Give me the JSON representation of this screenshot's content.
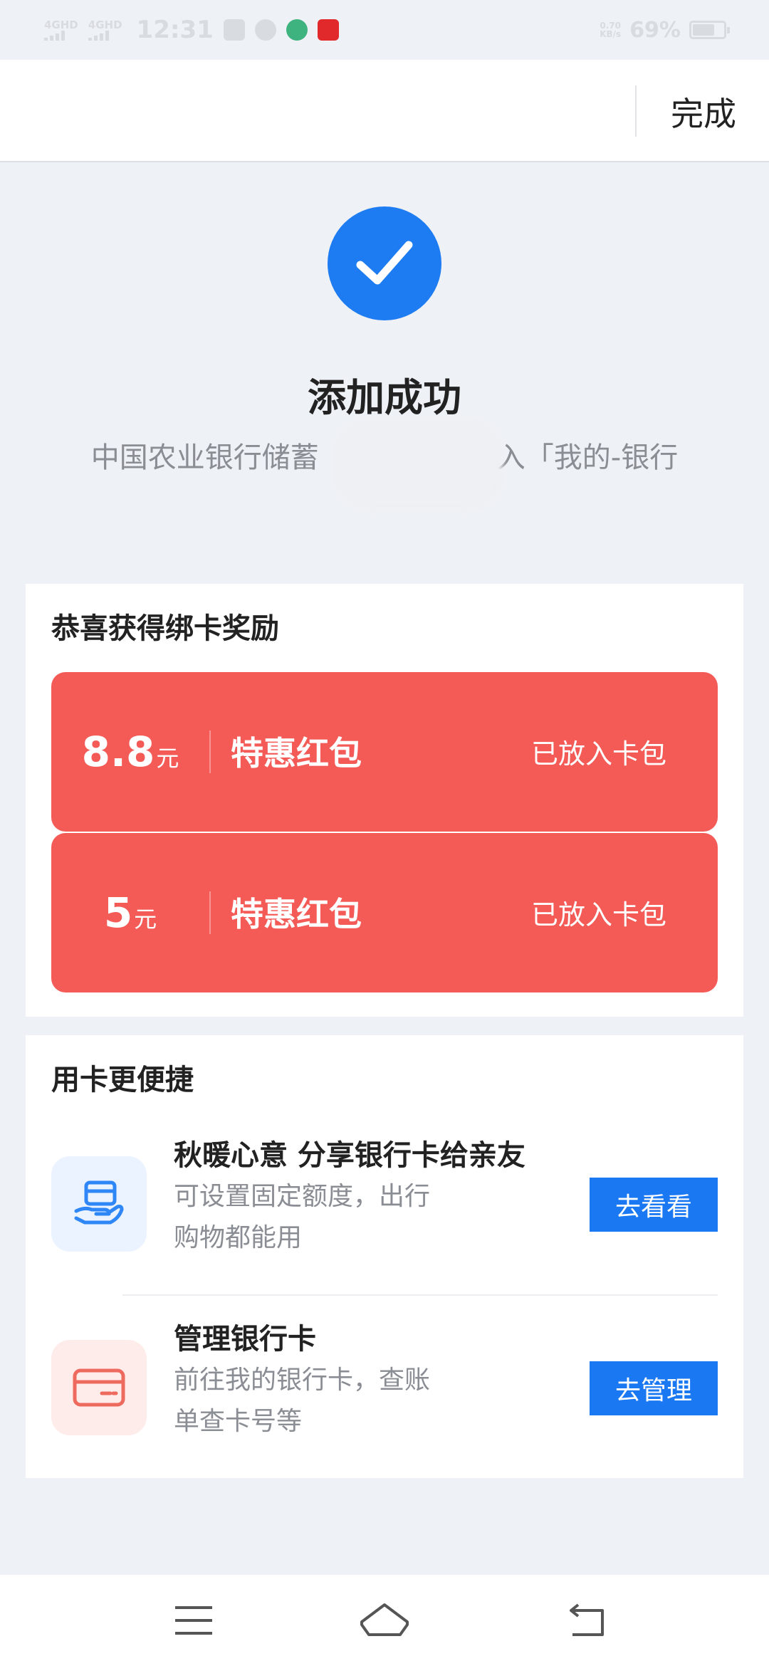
{
  "status_bar": {
    "network1": "4GHD",
    "network2": "4GHD",
    "time": "12:31",
    "speed_value": "0.70",
    "speed_unit": "KB/s",
    "battery": "69%",
    "battery_level": 0.69
  },
  "header": {
    "done_label": "完成"
  },
  "success": {
    "title": "添加成功",
    "subtitle_start": "中国农业银行储蓄",
    "subtitle_end": "入「我的-银行"
  },
  "rewards": {
    "title": "恭喜获得绑卡奖励",
    "coupons": [
      {
        "amount": "8.8",
        "unit": "元",
        "name": "特惠红包",
        "status": "已放入卡包"
      },
      {
        "amount": "5",
        "unit": "元",
        "name": "特惠红包",
        "status": "已放入卡包"
      }
    ]
  },
  "services": {
    "title": "用卡更便捷",
    "items": [
      {
        "title": "秋暖心意 分享银行卡给亲友",
        "desc": "可设置固定额度，出行购物都能用",
        "button": "去看看"
      },
      {
        "title": "管理银行卡",
        "desc": "前往我的银行卡，查账单查卡号等",
        "button": "去管理"
      }
    ]
  },
  "colors": {
    "accent_blue": "#1a78f2",
    "coupon_red": "#f45b57"
  }
}
